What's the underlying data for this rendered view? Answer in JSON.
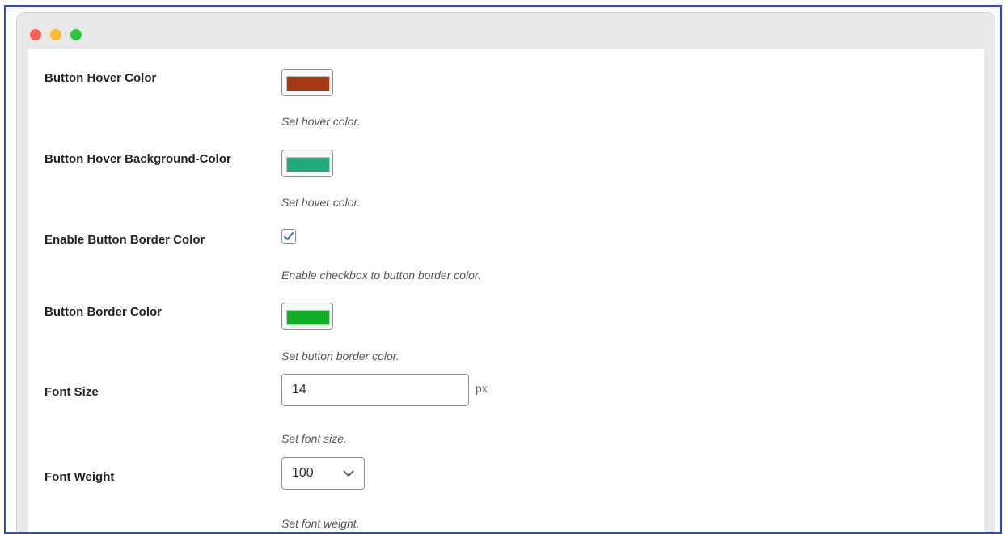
{
  "colors": {
    "hover_color": "#a63a12",
    "hover_bg_color": "#23a87a",
    "border_color": "#0fb027",
    "checkbox_check": "#2271b1",
    "frame_border": "#3949ab"
  },
  "window": {
    "controls": [
      "close-dot",
      "minimize-dot",
      "maximize-dot"
    ]
  },
  "settings": {
    "hover_color": {
      "label": "Button Hover Color",
      "description": "Set hover color."
    },
    "hover_bg_color": {
      "label": "Button Hover Background-Color",
      "description": "Set hover color."
    },
    "enable_border": {
      "label": "Enable Button Border Color",
      "checked": true,
      "description": "Enable checkbox to button border color."
    },
    "border_color": {
      "label": "Button Border Color",
      "description": "Set button border color."
    },
    "font_size": {
      "label": "Font Size",
      "value": "14",
      "unit": "px",
      "description": "Set font size."
    },
    "font_weight": {
      "label": "Font Weight",
      "selected": "100",
      "description": "Set font weight."
    }
  }
}
